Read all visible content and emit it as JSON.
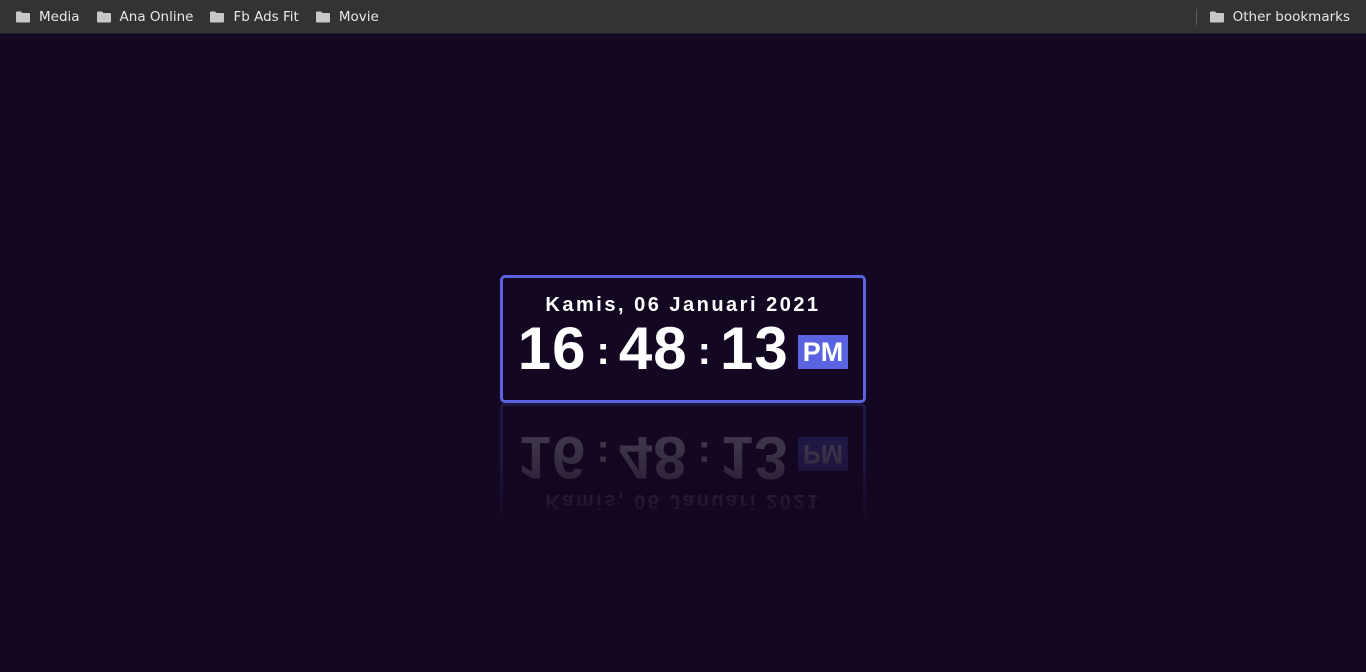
{
  "bookmarks_bar": {
    "items": [
      {
        "label": "Media",
        "icon": "folder-icon"
      },
      {
        "label": "Ana Online",
        "icon": "folder-icon"
      },
      {
        "label": "Fb Ads Fit",
        "icon": "folder-icon"
      },
      {
        "label": "Movie",
        "icon": "folder-icon"
      }
    ],
    "other": {
      "label": "Other bookmarks",
      "icon": "folder-icon"
    }
  },
  "clock": {
    "date": "Kamis, 06 Januari 2021",
    "hours": "16",
    "minutes": "48",
    "seconds": "13",
    "separator": ":",
    "period": "PM"
  },
  "colors": {
    "background": "#130721",
    "accent": "#5b64e0",
    "bar": "#333333",
    "text": "#ffffff"
  }
}
